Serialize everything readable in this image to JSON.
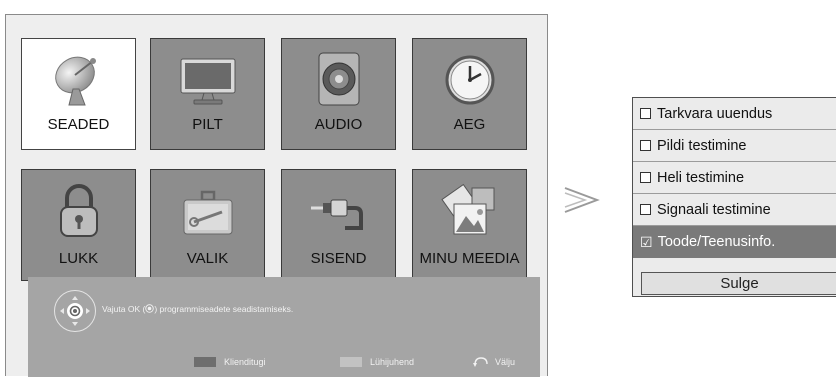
{
  "home_menu": {
    "tiles": [
      {
        "label": "SEADED",
        "icon": "satellite-dish-icon",
        "selected": true
      },
      {
        "label": "PILT",
        "icon": "tv-monitor-icon",
        "selected": false
      },
      {
        "label": "AUDIO",
        "icon": "speaker-icon",
        "selected": false
      },
      {
        "label": "AEG",
        "icon": "clock-icon",
        "selected": false
      },
      {
        "label": "LUKK",
        "icon": "padlock-icon",
        "selected": false
      },
      {
        "label": "VALIK",
        "icon": "toolbox-icon",
        "selected": false
      },
      {
        "label": "SISEND",
        "icon": "cable-plug-icon",
        "selected": false
      },
      {
        "label": "MINU MEEDIA",
        "icon": "media-frames-icon",
        "selected": false
      }
    ]
  },
  "help_bar": {
    "text_before": "Vajuta OK (",
    "text_after": ") programmiseadete seadistamiseks.",
    "legend": [
      {
        "label": "Klienditugi",
        "color": "#6e6e6e"
      },
      {
        "label": "Lühijuhend",
        "color": "#c2c2c2"
      },
      {
        "label": "Välju",
        "icon": "back-arrow-icon"
      }
    ]
  },
  "support_menu": {
    "items": [
      {
        "label": "Tarkvara uuendus",
        "checked": false,
        "active": false
      },
      {
        "label": "Pildi testimine",
        "checked": false,
        "active": false
      },
      {
        "label": "Heli testimine",
        "checked": false,
        "active": false
      },
      {
        "label": "Signaali testimine",
        "checked": false,
        "active": false
      },
      {
        "label": "Toode/Teenusinfo.",
        "checked": true,
        "active": true
      }
    ],
    "close_label": "Sulge"
  },
  "colors": {
    "panel_bg": "#eeeeee",
    "tile_bg": "#8d8d8d",
    "tile_selected_bg": "#ffffff",
    "help_bg": "#a5a5a5",
    "menu_active_bg": "#7a7a7a"
  }
}
